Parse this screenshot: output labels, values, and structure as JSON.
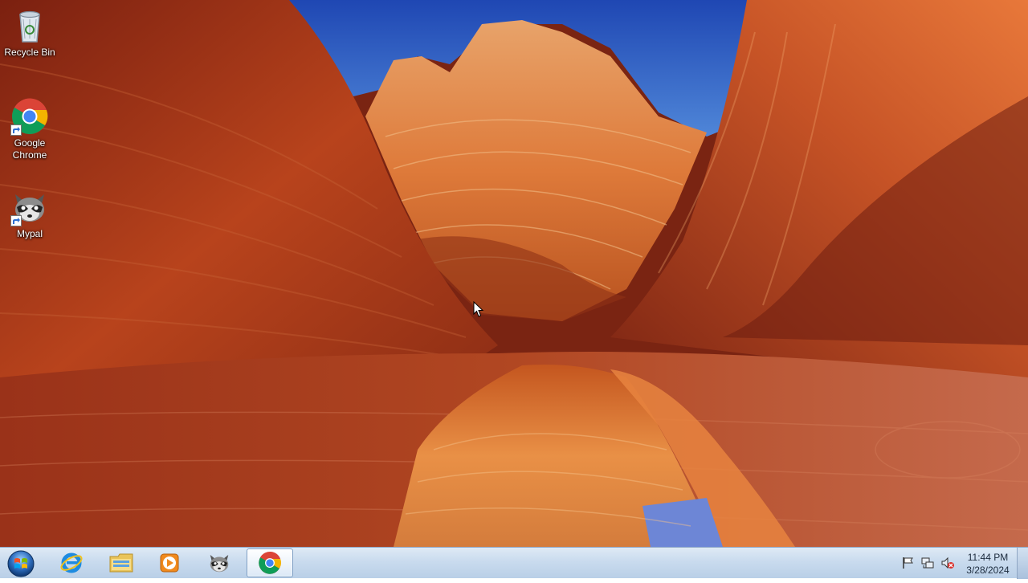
{
  "desktop": {
    "icons": [
      {
        "label": "Recycle Bin",
        "icon": "recycle-bin-icon"
      },
      {
        "label": "Google\nChrome",
        "label_line1": "Google",
        "label_line2": "Chrome",
        "icon": "chrome-icon",
        "shortcut": true
      },
      {
        "label": "Mypal",
        "icon": "mypal-raccoon-icon",
        "shortcut": true
      }
    ]
  },
  "taskbar": {
    "start": {
      "icon": "windows-start-orb"
    },
    "pinned": [
      {
        "name": "Internet Explorer",
        "icon": "internet-explorer-icon"
      },
      {
        "name": "Windows Explorer",
        "icon": "folder-explorer-icon"
      },
      {
        "name": "Windows Media Player",
        "icon": "media-player-icon"
      },
      {
        "name": "Mypal",
        "icon": "mypal-raccoon-icon"
      },
      {
        "name": "Google Chrome",
        "icon": "chrome-icon",
        "active": true
      }
    ],
    "tray": {
      "icons": [
        "action-center-flag-icon",
        "network-icon",
        "volume-muted-icon"
      ],
      "time": "11:44 PM",
      "date": "3/28/2024"
    }
  },
  "colors": {
    "taskbar_top": "#dfeaf5",
    "taskbar_bottom": "#b9cfe7",
    "sky": "#2c5bbf",
    "rock_dark": "#7a2412",
    "rock_bright": "#e98a3e"
  }
}
